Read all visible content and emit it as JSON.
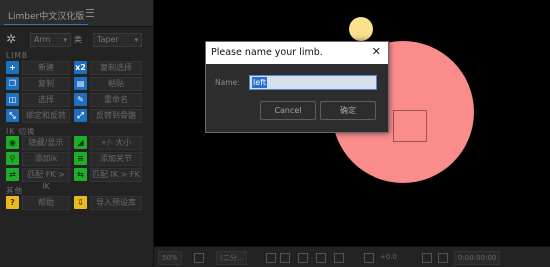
{
  "panel": {
    "title": "Limber中文汉化版",
    "dropdown_arm": "Arm",
    "dropdown_label": "类",
    "dropdown_taper": "Taper",
    "section_limb": "LIMB",
    "section_ik": "IK 切换",
    "section_other": "其他",
    "buttons": [
      {
        "icon": "+",
        "label": "新建"
      },
      {
        "icon": "x2",
        "label": "复制选择"
      },
      {
        "icon": "❐",
        "label": "复制"
      },
      {
        "icon": "▤",
        "label": "粘贴"
      },
      {
        "icon": "◫",
        "label": "选择"
      },
      {
        "icon": "✎",
        "label": "重命名"
      },
      {
        "icon": "⤡",
        "label": "绑定和反转"
      },
      {
        "icon": "⤢",
        "label": "反转到骨骼"
      }
    ],
    "ik_buttons": [
      {
        "icon": "◉",
        "label": "隐藏/显示"
      },
      {
        "icon": "◢",
        "label": "+/- 大小"
      },
      {
        "icon": "⚲",
        "label": "添加ik"
      },
      {
        "icon": "≡",
        "label": "添加关节"
      },
      {
        "icon": "⇄",
        "label": "匹配 FK > IK"
      },
      {
        "icon": "⇆",
        "label": "匹配 IK > FK"
      }
    ],
    "other_buttons": [
      {
        "icon": "?",
        "label": "帮助"
      },
      {
        "icon": "⇩",
        "label": "导入预设库"
      }
    ]
  },
  "statusbar": {
    "zoom": "50%",
    "resolution": "(二分...",
    "exposure": "+0.0",
    "timecode": "0:00:00:00"
  },
  "dialog": {
    "title": "Please name your limb.",
    "close": "✕",
    "name_label": "Name:",
    "name_value": "left",
    "cancel_label": "Cancel",
    "ok_label": "确定"
  },
  "colors": {
    "big_circle": "#fb8c8c",
    "small_circle": "#fbe08e",
    "blue_button": "#1f6fc0",
    "green_button": "#1fae2a",
    "help_button": "#e8b923"
  }
}
